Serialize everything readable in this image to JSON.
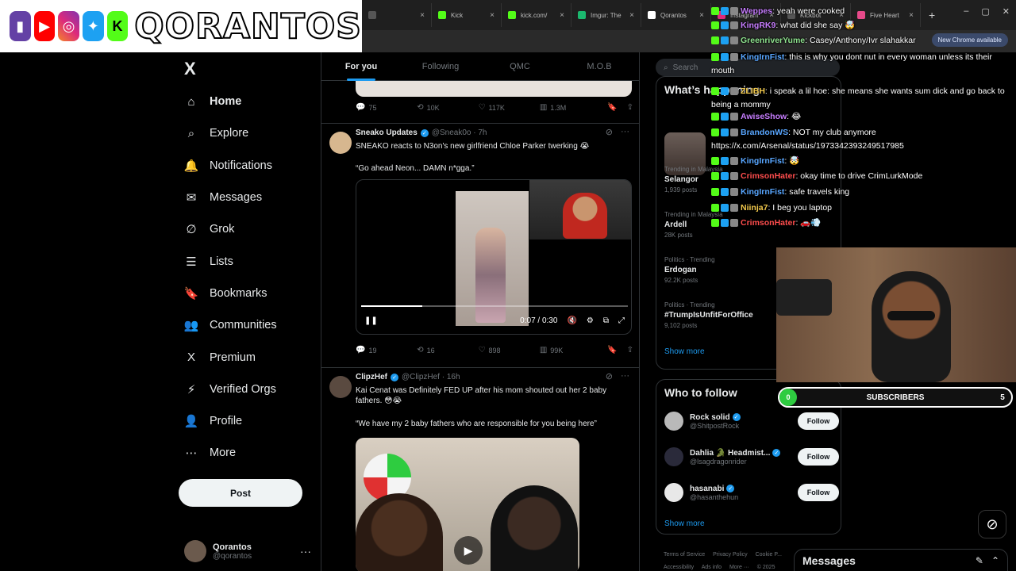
{
  "browser": {
    "tabs": [
      {
        "label": "",
        "close": "×"
      },
      {
        "label": "Kick",
        "close": "×"
      },
      {
        "label": "kick.com/",
        "close": "×"
      },
      {
        "label": "Imgur: The",
        "close": "×"
      },
      {
        "label": "Qorantos",
        "close": "×"
      },
      {
        "label": "Instagram",
        "close": "×"
      },
      {
        "label": "Kickbot",
        "close": "×"
      },
      {
        "label": "Five Heart",
        "close": "×"
      }
    ],
    "new_tab": "+",
    "window_controls": [
      "–",
      "▢",
      "✕"
    ],
    "new_chrome_banner": "New Chrome available"
  },
  "overlay": {
    "name": "QORANTOS",
    "social_icons": [
      "twitch-icon",
      "youtube-icon",
      "instagram-icon",
      "twitter-icon",
      "kick-icon"
    ]
  },
  "nav": {
    "logo": "X",
    "items": [
      {
        "label": "Home",
        "icon": "⌂"
      },
      {
        "label": "Explore",
        "icon": "⌕"
      },
      {
        "label": "Notifications",
        "icon": "🔔"
      },
      {
        "label": "Messages",
        "icon": "✉"
      },
      {
        "label": "Grok",
        "icon": "∅"
      },
      {
        "label": "Lists",
        "icon": "☰"
      },
      {
        "label": "Bookmarks",
        "icon": "🔖"
      },
      {
        "label": "Communities",
        "icon": "👥"
      },
      {
        "label": "Premium",
        "icon": "X"
      },
      {
        "label": "Verified Orgs",
        "icon": "⚡"
      },
      {
        "label": "Profile",
        "icon": "👤"
      },
      {
        "label": "More",
        "icon": "⋯"
      }
    ],
    "post_label": "Post",
    "profile_name": "Qorantos",
    "profile_handle": "@qorantos",
    "profile_more": "···"
  },
  "timeline": {
    "tabs": [
      "For you",
      "Following",
      "QMC",
      "M.O.B"
    ],
    "prev_actions": {
      "replies": "75",
      "reposts": "10K",
      "likes": "117K",
      "views": "1.3M"
    },
    "tweets": [
      {
        "name": "Sneako Updates",
        "handle": "@Sneak0o · 7h",
        "text": "SNEAKO reacts to N3on's new girlfriend Chloe Parker twerking 😭",
        "quote": "“Go ahead Neon... DAMN n*gga.”",
        "video_time": "0:07 / 0:30",
        "video_progress": 0.23,
        "replies": "19",
        "reposts": "16",
        "likes": "898",
        "views": "99K"
      },
      {
        "name": "ClipzHef",
        "handle": "@ClipzHef · 16h",
        "text": "Kai Cenat was Definitely FED UP after his mom shouted out her 2 baby fathers. 😳😭",
        "quote": "“We have my 2 baby fathers who are responsible for you being here”"
      }
    ]
  },
  "sidebar": {
    "search_placeholder": "Search",
    "happening_title": "What’s happening",
    "trends": [
      {
        "context": "Trending in Malaysia",
        "name": "Selangor",
        "count": "1,939 posts"
      },
      {
        "context": "Trending in Malaysia",
        "name": "Ardell",
        "count": "28K posts"
      },
      {
        "context": "Politics · Trending",
        "name": "Erdogan",
        "count": "92.2K posts"
      },
      {
        "context": "Politics · Trending",
        "name": "#TrumpIsUnfitForOffice",
        "count": "9,102 posts"
      }
    ],
    "show_more": "Show more",
    "who_to_follow_title": "Who to follow",
    "follow_suggestions": [
      {
        "name": "Rock solid",
        "handle": "@ShitpostRock",
        "button": "Follow"
      },
      {
        "name": "Dahlia 🐊 Headmist...",
        "handle": "@lsagdragonrider",
        "button": "Follow"
      },
      {
        "name": "hasanabi",
        "handle": "@hasanthehun",
        "button": "Follow"
      }
    ],
    "show_more_2": "Show more",
    "footer": [
      "Terms of Service",
      "Privacy Policy",
      "Cookie P...",
      "Accessibility",
      "Ads info",
      "More ···",
      "© 2025"
    ]
  },
  "chat": {
    "messages": [
      {
        "user": "Weppes",
        "color": "#c77dff",
        "text": ": yeah were cooked"
      },
      {
        "user": "KingRK9",
        "color": "#c77dff",
        "text": ": what did she say 🤯"
      },
      {
        "user": "GreenriverYume",
        "color": "#8fe38f",
        "text": ": Casey/Anthony/Ivr slahakkar"
      },
      {
        "user": "KingIrnFist",
        "color": "#58a6ff",
        "text": ": this is why you dont nut in every woman unless its their mouth"
      },
      {
        "user": "ZLIBH",
        "color": "#f2c94c",
        "text": ": i speak a lil hoe: she means she wants sum dick and go back to being a mommy"
      },
      {
        "user": "AwiseShow",
        "color": "#c77dff",
        "text": ": 😂"
      },
      {
        "user": "BrandonWS",
        "color": "#58a6ff",
        "text": ": NOT my club anymore https://x.com/Arsenal/status/1973342393249517985"
      },
      {
        "user": "KingIrnFist",
        "color": "#58a6ff",
        "text": ": 🤯"
      },
      {
        "user": "CrimsonHater",
        "color": "#ff4d4d",
        "text": ": okay time to drive CrimLurkMode"
      },
      {
        "user": "KingIrnFist",
        "color": "#58a6ff",
        "text": ": safe travels king"
      },
      {
        "user": "Niinja7",
        "color": "#f2c94c",
        "text": ": I beg you laptop"
      },
      {
        "user": "CrimsonHater",
        "color": "#ff4d4d",
        "text": ": 🚗💨"
      }
    ]
  },
  "subs": {
    "start": "0",
    "label": "SUBSCRIBERS",
    "goal": "5"
  },
  "messages_dock": {
    "title": "Messages"
  },
  "colors": {
    "accent": "#1d9bf0",
    "kick_green": "#53fc18"
  }
}
